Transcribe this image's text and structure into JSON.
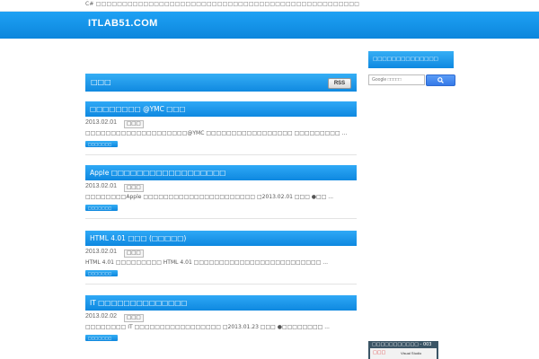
{
  "topbar": {
    "text": "C# □□□□□□□□□□□□□□□□□□□□□□□□□□□□□□□□□□□□□□□□□□□□□□□□□□"
  },
  "header": {
    "site_title": "ITLAB51.COM"
  },
  "main": {
    "section_title": "□□□",
    "rss_label": "RSS",
    "posts": [
      {
        "title": "□□□□□□□□ @YMC □□□",
        "date": "2013.02.01",
        "category": "□□□",
        "excerpt": "□□□□□□□□□□□□□□□□□□□□@YMC □□□□□□□□□□□□□□□□□ □□□□□□□□□ ...",
        "more": "□□□□□□□"
      },
      {
        "title": "Apple □□□□□□□□□□□□□□□□□□",
        "date": "2013.02.01",
        "category": "□□□",
        "excerpt": "□□□□□□□□Apple □□□□□□□□□□□□□□□□□□□□□□ □2013.02.01 □□□ ●□□ ...",
        "more": "□□□□□□□"
      },
      {
        "title": "HTML 4.01 □□□ (□□□□□)",
        "date": "2013.02.01",
        "category": "□□□",
        "excerpt": "HTML 4.01 □□□□□□□□□ HTML 4.01 □□□□□□□□□□□□□□□□□□□□□□□□□ ...",
        "more": "□□□□□□□"
      },
      {
        "title": "IT □□□□□□□□□□□□□□",
        "date": "2013.02.02",
        "category": "□□□",
        "excerpt": "□□□□□□□□ IT □□□□□□□□□□□□□□□□□ □2013.01.23 □□□ ●□□□□□□□□ ...",
        "more": "□□□□□□□"
      }
    ]
  },
  "sidebar": {
    "title": "□□□□□□□□□□□□□□",
    "search_placeholder": "Google □□□□□"
  },
  "ad": {
    "title": "□□□□□□□□□□□ - 003",
    "logo": "□□□",
    "text": "Visual Studio"
  }
}
